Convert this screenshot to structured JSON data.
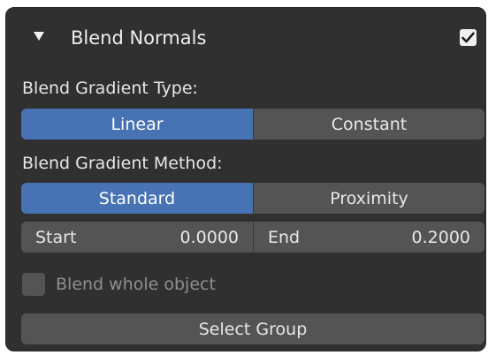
{
  "panel": {
    "title": "Blend Normals",
    "enabled": true,
    "icons": {
      "disclosure": "triangle-down-icon",
      "enabled_checkbox": "checkmark-icon"
    }
  },
  "gradient_type": {
    "label": "Blend Gradient Type:",
    "options": [
      "Linear",
      "Constant"
    ],
    "selected": "Linear"
  },
  "gradient_method": {
    "label": "Blend Gradient Method:",
    "options": [
      "Standard",
      "Proximity"
    ],
    "selected": "Standard"
  },
  "range": {
    "start_label": "Start",
    "start_value": "0.0000",
    "end_label": "End",
    "end_value": "0.2000"
  },
  "blend_whole_object": {
    "label": "Blend whole object",
    "checked": false
  },
  "select_group_label": "Select Group",
  "colors": {
    "panel_bg": "#303030",
    "field_bg": "#545454",
    "accent": "#4772b3",
    "text": "#e8e8e8",
    "disabled_text": "#8f8f8f"
  }
}
